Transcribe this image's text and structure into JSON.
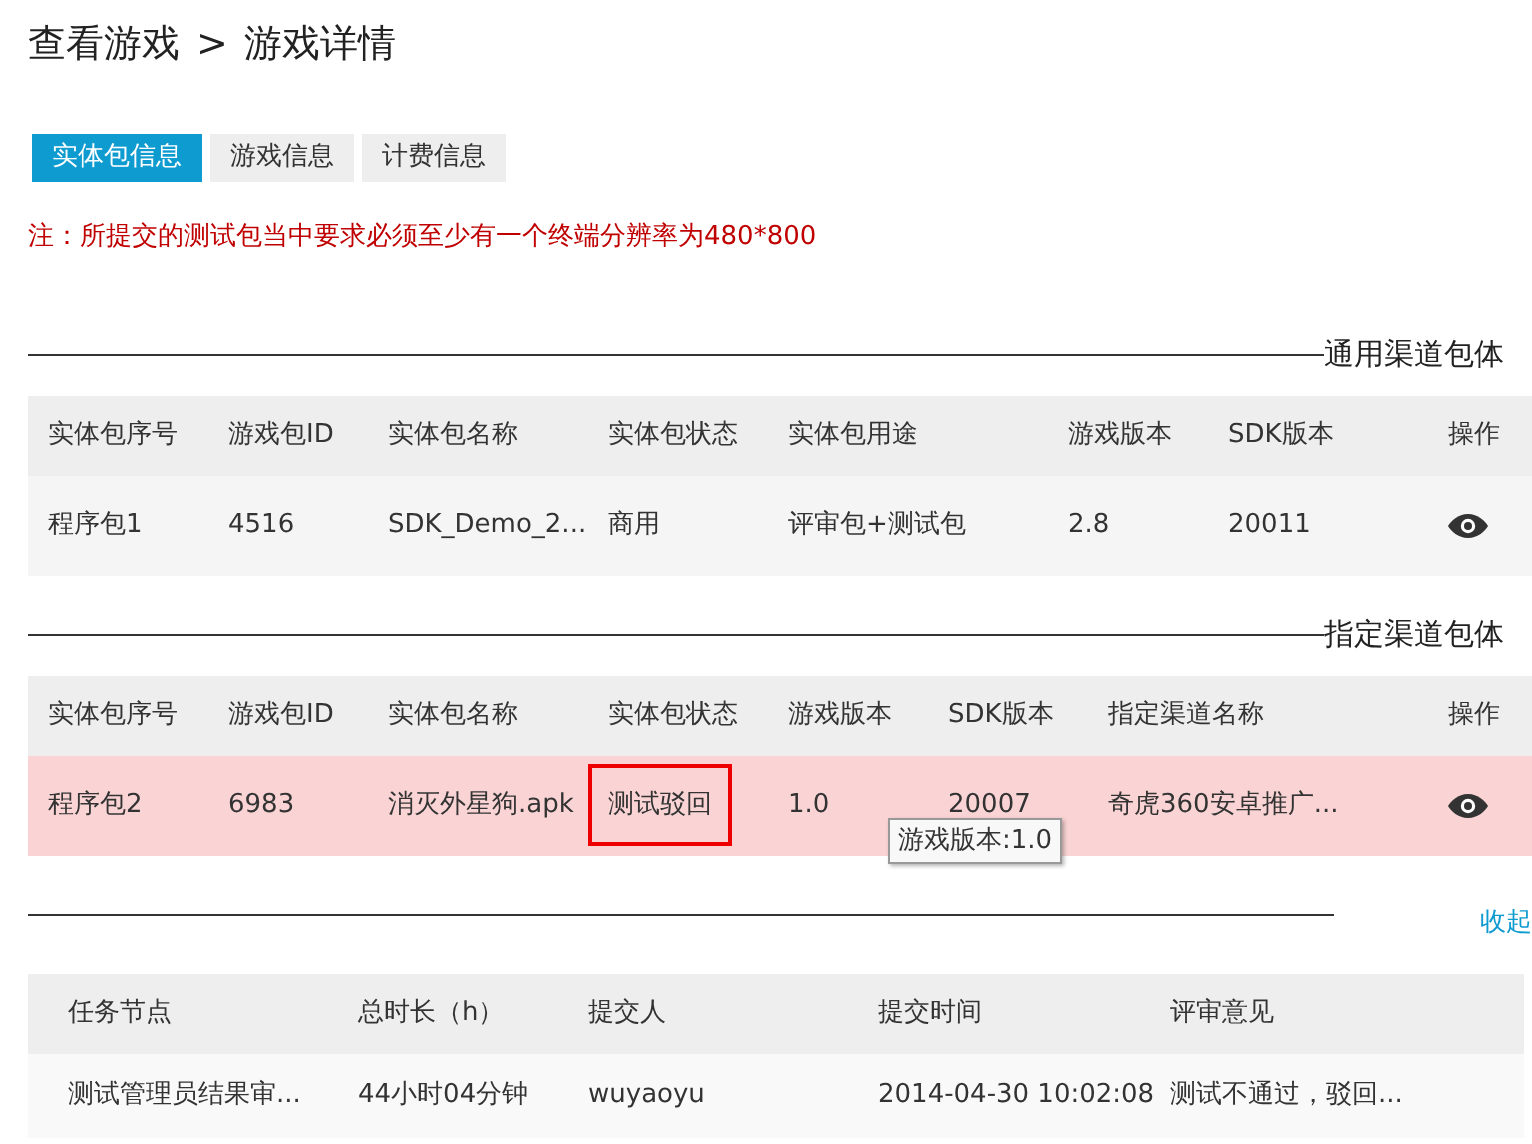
{
  "breadcrumb": {
    "parent": "查看游戏",
    "separator": ">",
    "current": "游戏详情"
  },
  "tabs": [
    {
      "label": "实体包信息",
      "selected": true
    },
    {
      "label": "游戏信息",
      "selected": false
    },
    {
      "label": "计费信息",
      "selected": false
    }
  ],
  "notice": "注：所提交的测试包当中要求必须至少有一个终端分辨率为480*800",
  "general_packages": {
    "title": "通用渠道包体",
    "columns": [
      "实体包序号",
      "游戏包ID",
      "实体包名称",
      "实体包状态",
      "实体包用途",
      "游戏版本",
      "SDK版本",
      "操作"
    ],
    "rows": [
      {
        "cells": [
          "程序包1",
          "4516",
          "SDK_Demo_2...",
          "商用",
          "评审包+测试包",
          "2.8",
          "20011"
        ],
        "highlighted": false,
        "status_flagged": false
      }
    ]
  },
  "channel_packages": {
    "title": "指定渠道包体",
    "columns": [
      "实体包序号",
      "游戏包ID",
      "实体包名称",
      "实体包状态",
      "游戏版本",
      "SDK版本",
      "指定渠道名称",
      "操作"
    ],
    "rows": [
      {
        "cells": [
          "程序包2",
          "6983",
          "消灭外星狗.apk",
          "测试驳回",
          "1.0",
          "20007",
          "奇虎360安卓推广..."
        ],
        "highlighted": true,
        "status_flagged": true
      }
    ],
    "tooltip": "游戏版本:1.0"
  },
  "collapse_link": "收起",
  "review_history": {
    "columns": [
      "任务节点",
      "总时长（h）",
      "提交人",
      "提交时间",
      "评审意见"
    ],
    "rows": [
      [
        "测试管理员结果审...",
        "44小时04分钟",
        "wuyaoyu",
        "2014-04-30 10:02:08",
        "测试不通过，驳回..."
      ]
    ]
  }
}
